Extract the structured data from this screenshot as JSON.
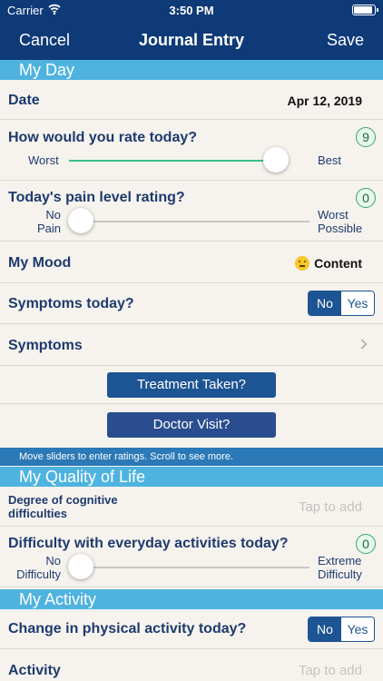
{
  "status_bar": {
    "carrier": "Carrier",
    "time": "3:50 PM"
  },
  "nav": {
    "cancel": "Cancel",
    "title": "Journal Entry",
    "save": "Save"
  },
  "my_day": {
    "header": "My Day",
    "date": {
      "label": "Date",
      "value": "Apr 12, 2019"
    },
    "rate_today": {
      "label": "How would you rate today?",
      "min_label": "Worst",
      "max_label": "Best",
      "value": "9",
      "fraction": 0.9
    },
    "pain_level": {
      "label": "Today's pain level rating?",
      "min_label": "No Pain",
      "min_line1": "No",
      "min_line2": "Pain",
      "max_line1": "Worst",
      "max_line2": "Possible",
      "value": "0",
      "fraction": 0
    },
    "mood": {
      "label": "My Mood",
      "value": "Content",
      "icon": "slightly-smiling-face-icon"
    },
    "symptoms_today": {
      "label": "Symptoms today?",
      "no": "No",
      "yes": "Yes",
      "selected": "No"
    },
    "symptoms": {
      "label": "Symptoms"
    },
    "treatment_button": "Treatment Taken?",
    "doctor_button": "Doctor Visit?"
  },
  "hint": "Move sliders to enter ratings. Scroll to see more.",
  "quality_of_life": {
    "header": "My Quality of Life",
    "cognitive": {
      "label_line1": "Degree of cognitive",
      "label_line2": "difficulties",
      "placeholder": "Tap to add"
    },
    "everyday": {
      "label": "Difficulty with everyday activities today?",
      "min_line1": "No",
      "min_line2": "Difficulty",
      "max_line1": "Extreme",
      "max_line2": "Difficulty",
      "value": "0",
      "fraction": 0
    }
  },
  "activity": {
    "header": "My Activity",
    "physical_change": {
      "label": "Change in physical activity today?",
      "no": "No",
      "yes": "Yes",
      "selected": "No"
    },
    "activity": {
      "label": "Activity",
      "placeholder": "Tap to add"
    }
  },
  "colors": {
    "nav_bg": "#0f3a78",
    "section_bg": "#4fb3e0",
    "label_text": "#1e3a6e",
    "treatment_btn": "#1d5493",
    "doctor_btn": "#2a4d8f",
    "slider_active": "#3bc08a"
  }
}
